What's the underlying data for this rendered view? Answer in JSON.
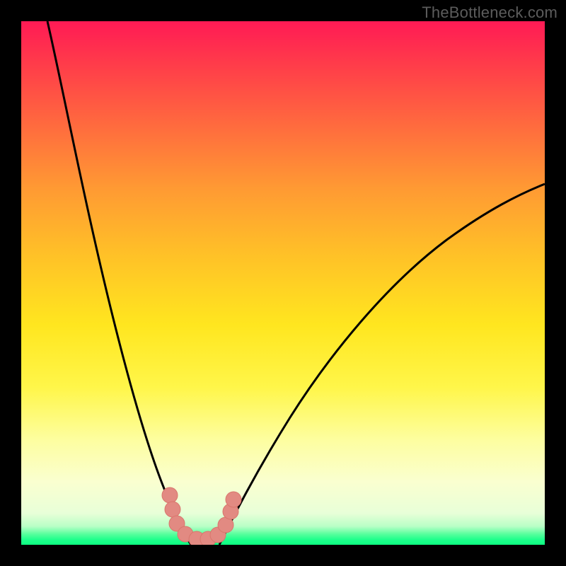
{
  "watermark": "TheBottleneck.com",
  "chart_data": {
    "type": "line",
    "title": "",
    "xlabel": "",
    "ylabel": "",
    "x_range": [
      0,
      100
    ],
    "y_range": [
      0,
      100
    ],
    "background": "rainbow_vertical_gradient",
    "gradient_stops": [
      {
        "pos": 0,
        "color": "#ff1a55"
      },
      {
        "pos": 50,
        "color": "#ffe61f"
      },
      {
        "pos": 95,
        "color": "#e8ffd8"
      },
      {
        "pos": 100,
        "color": "#0dff82"
      }
    ],
    "series": [
      {
        "name": "left_curve",
        "color": "#000000",
        "x": [
          5,
          10,
          15,
          20,
          23,
          26,
          28,
          30,
          32
        ],
        "y": [
          100,
          73,
          50,
          30,
          19,
          10,
          5,
          2,
          0
        ]
      },
      {
        "name": "right_curve",
        "color": "#000000",
        "x": [
          38,
          40,
          45,
          50,
          60,
          70,
          80,
          90,
          100
        ],
        "y": [
          0,
          3,
          12,
          22,
          38,
          50,
          58,
          64,
          69
        ]
      },
      {
        "name": "bottom_marker_cluster",
        "type": "scatter",
        "color": "#e28a82",
        "x": [
          28,
          29,
          31,
          33,
          35,
          37,
          38,
          40
        ],
        "y": [
          8,
          4,
          1,
          0.5,
          0.5,
          1,
          4,
          8
        ]
      }
    ],
    "notes": "V-shaped bottleneck curve. Minimum (optimal) occurs around x≈34. Pink markers cluster around valley bottom. No axis ticks or numeric labels visible."
  }
}
